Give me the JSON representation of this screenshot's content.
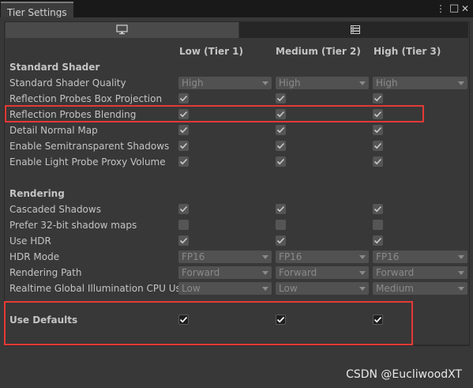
{
  "window": {
    "tab_title": "Tier Settings",
    "menu_glyph": "⋮",
    "maximize_glyph": "□",
    "close_glyph": "✕"
  },
  "tiers": [
    "Low (Tier 1)",
    "Medium (Tier 2)",
    "High (Tier 3)"
  ],
  "sections": {
    "standard_shader": {
      "title": "Standard Shader",
      "rows": [
        {
          "label": "Standard Shader Quality",
          "kind": "dropdown",
          "values": [
            "High",
            "High",
            "High"
          ]
        },
        {
          "label": "Reflection Probes Box Projection",
          "kind": "checkbox",
          "values": [
            true,
            true,
            true
          ]
        },
        {
          "label": "Reflection Probes Blending",
          "kind": "checkbox",
          "values": [
            true,
            true,
            true
          ]
        },
        {
          "label": "Detail Normal Map",
          "kind": "checkbox",
          "values": [
            true,
            true,
            true
          ]
        },
        {
          "label": "Enable Semitransparent Shadows",
          "kind": "checkbox",
          "values": [
            true,
            true,
            true
          ]
        },
        {
          "label": "Enable Light Probe Proxy Volume",
          "kind": "checkbox",
          "values": [
            true,
            true,
            true
          ]
        }
      ]
    },
    "rendering": {
      "title": "Rendering",
      "rows": [
        {
          "label": "Cascaded Shadows",
          "kind": "checkbox",
          "values": [
            true,
            true,
            true
          ]
        },
        {
          "label": "Prefer 32-bit shadow maps",
          "kind": "checkbox",
          "values": [
            false,
            false,
            false
          ]
        },
        {
          "label": "Use HDR",
          "kind": "checkbox",
          "values": [
            true,
            true,
            true
          ]
        },
        {
          "label": "HDR Mode",
          "kind": "dropdown",
          "values": [
            "FP16",
            "FP16",
            "FP16"
          ]
        },
        {
          "label": "Rendering Path",
          "kind": "dropdown",
          "values": [
            "Forward",
            "Forward",
            "Forward"
          ]
        },
        {
          "label": "Realtime Global Illumination CPU Usa",
          "kind": "dropdown",
          "values": [
            "Low",
            "Low",
            "Medium"
          ]
        }
      ]
    }
  },
  "use_defaults": {
    "label": "Use Defaults",
    "values": [
      true,
      true,
      true
    ]
  },
  "watermark": "CSDN @EucliwoodXT",
  "highlight_color": "#e53935"
}
